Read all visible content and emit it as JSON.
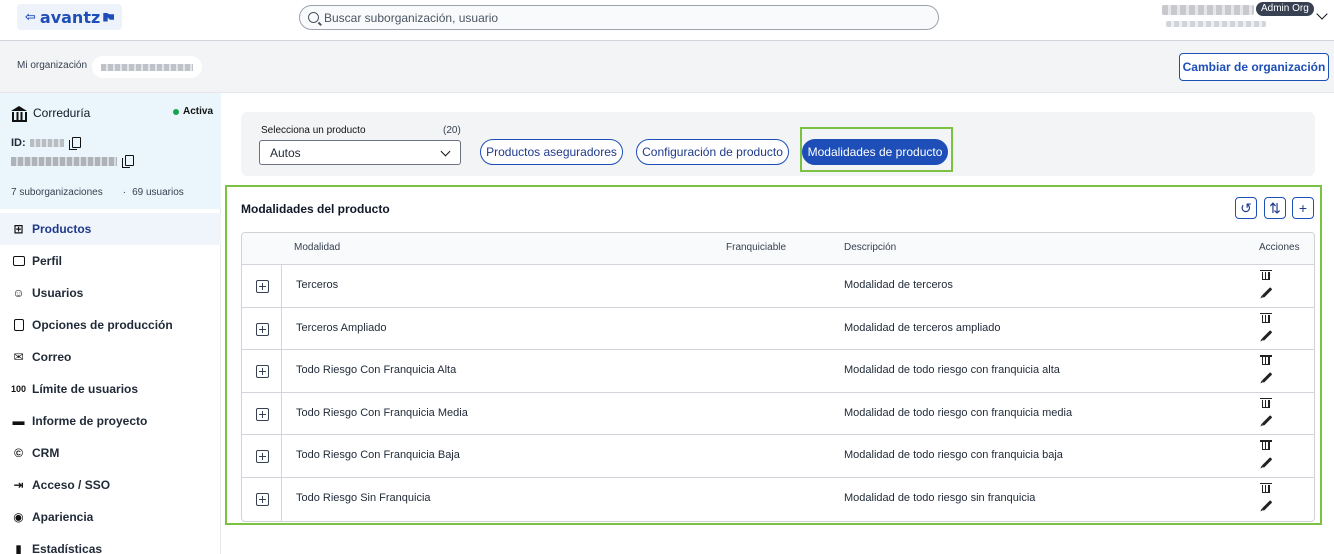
{
  "header": {
    "logo_text": "avantz",
    "search_placeholder": "Buscar suborganización, usuario",
    "role_badge": "Admin Org"
  },
  "orgbar": {
    "label": "Mi organización",
    "change_button": "Cambiar de organización"
  },
  "sidebar": {
    "org_type": "Correduría",
    "status": "Activa",
    "id_label": "ID:",
    "suborgs": "7 suborganizaciones",
    "separator": "·",
    "users": "69 usuarios",
    "items": [
      {
        "label": "Productos",
        "icon": "products-icon"
      },
      {
        "label": "Perfil",
        "icon": "profile-icon"
      },
      {
        "label": "Usuarios",
        "icon": "users-icon"
      },
      {
        "label": "Opciones de producción",
        "icon": "clipboard-icon"
      },
      {
        "label": "Correo",
        "icon": "mail-icon"
      },
      {
        "label": "Límite de usuarios",
        "icon": "hundred-icon"
      },
      {
        "label": "Informe de proyecto",
        "icon": "folder-icon"
      },
      {
        "label": "CRM",
        "icon": "copyright-icon"
      },
      {
        "label": "Acceso / SSO",
        "icon": "login-icon"
      },
      {
        "label": "Apariencia",
        "icon": "eye-icon"
      },
      {
        "label": "Estadísticas",
        "icon": "bar-chart-icon"
      }
    ]
  },
  "filters": {
    "select_label": "Selecciona un producto",
    "count": "(20)",
    "selected_product": "Autos",
    "tabs": [
      "Productos aseguradores",
      "Configuración de producto",
      "Modalidades de producto"
    ]
  },
  "section": {
    "title": "Modalidades del producto"
  },
  "table": {
    "headers": [
      "Modalidad",
      "Franquiciable",
      "Descripción",
      "Acciones"
    ],
    "rows": [
      {
        "modalidad": "Terceros",
        "descripcion": "Modalidad de terceros"
      },
      {
        "modalidad": "Terceros Ampliado",
        "descripcion": "Modalidad de terceros ampliado"
      },
      {
        "modalidad": "Todo Riesgo Con Franquicia Alta",
        "descripcion": "Modalidad de todo riesgo con franquicia alta"
      },
      {
        "modalidad": "Todo Riesgo Con Franquicia Media",
        "descripcion": "Modalidad de todo riesgo con franquicia media"
      },
      {
        "modalidad": "Todo Riesgo Con Franquicia Baja",
        "descripcion": "Modalidad de todo riesgo con franquicia baja"
      },
      {
        "modalidad": "Todo Riesgo Sin Franquicia",
        "descripcion": "Modalidad de todo riesgo sin franquicia"
      }
    ]
  },
  "colors": {
    "primary": "#1e4fb8",
    "highlight": "#7cc242",
    "active_status": "#16a34a"
  }
}
